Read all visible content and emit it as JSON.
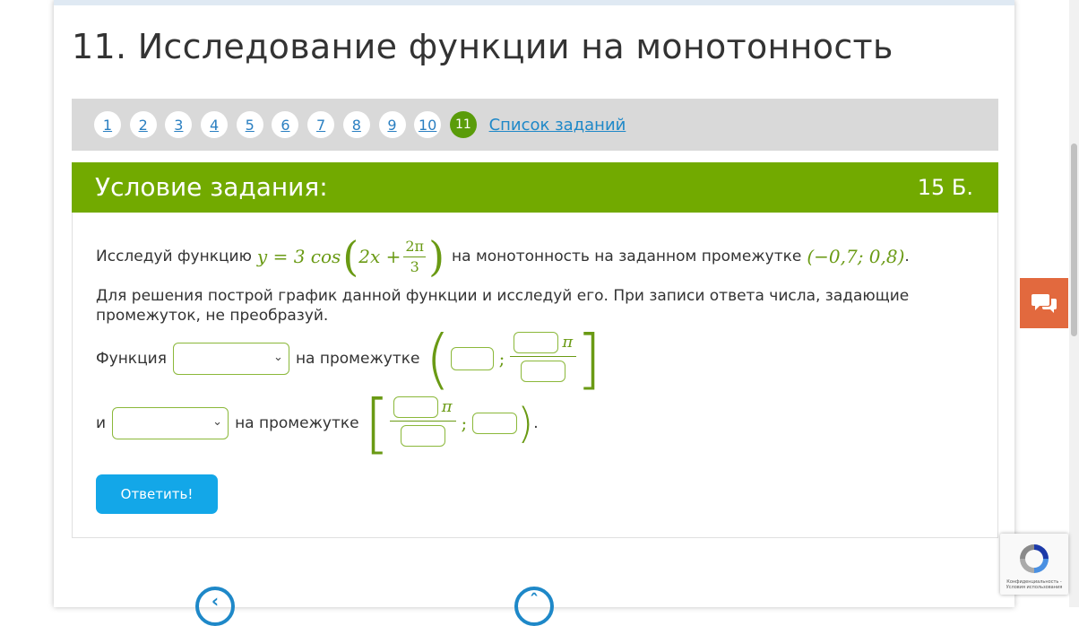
{
  "page": {
    "title": "11. Исследование функции на монотонность"
  },
  "nav": {
    "numbers": [
      "1",
      "2",
      "3",
      "4",
      "5",
      "6",
      "7",
      "8",
      "9",
      "10",
      "11"
    ],
    "active_index": 10,
    "all_tasks_label": "Список заданий"
  },
  "task": {
    "header_title": "Условие задания:",
    "points": "15 Б.",
    "line1_prefix": "Исследуй функцию",
    "formula_lhs": "y = 3 cos",
    "formula_inner": "2x +",
    "frac_num": "2π",
    "frac_den": "3",
    "line1_middle": "на монотонность на заданном промежутке",
    "interval": "(−0,7; 0,8)",
    "line1_end": ".",
    "line2": "Для решения построй график данной функции и исследуй его. При записи ответа числа, задающие промежуток, не преобразуй.",
    "row1_label": "Функция",
    "row1_middle": "на промежутке",
    "row2_label": "и",
    "row2_middle": "на промежутке",
    "pi_symbol": "π",
    "semicolon": ";",
    "row2_end": ".",
    "select1_value": "",
    "select2_value": ""
  },
  "answer_button": "Ответить!",
  "recaptcha_text": "Конфиденциальность - Условия использования",
  "colors": {
    "header_green": "#72aa00",
    "active_nav": "#5a9c0a",
    "answer_button": "#13a7e8",
    "chat_button": "#e2693e"
  }
}
